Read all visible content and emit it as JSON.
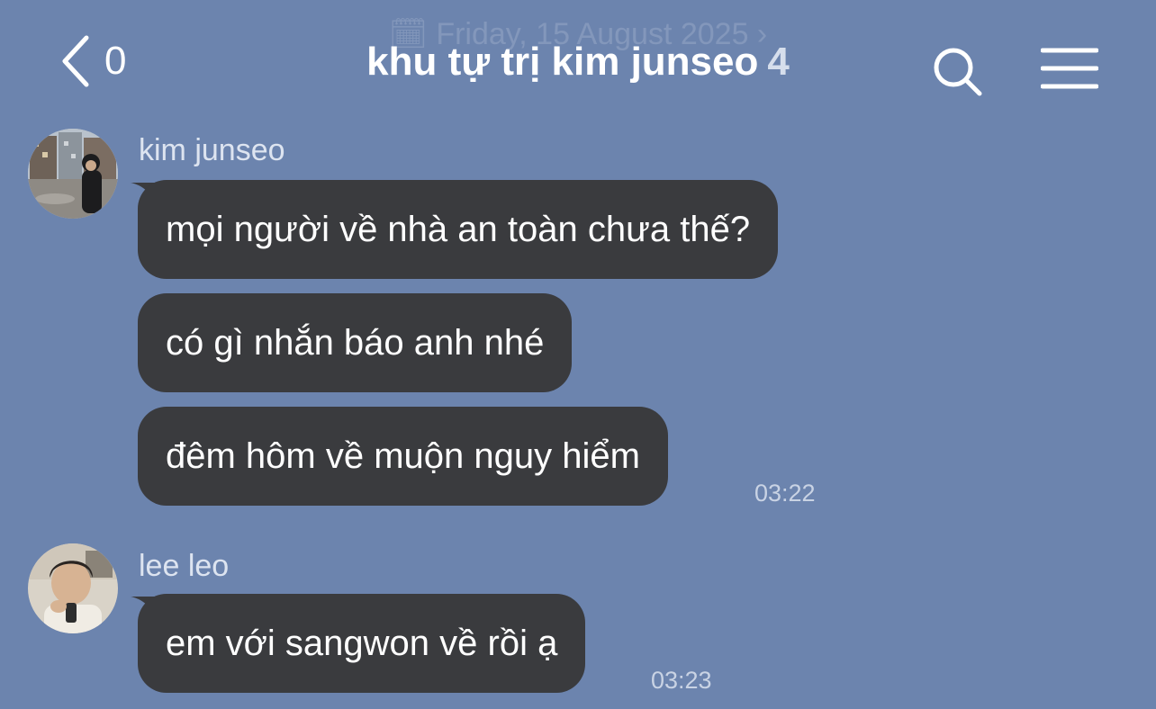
{
  "header": {
    "date_banner": "🗓 Friday, 15 August 2025 ›",
    "back_count": "0",
    "chat_title": "khu tự trị kim junseo",
    "member_count": "4"
  },
  "messages": [
    {
      "sender": "kim junseo",
      "bubbles": [
        "mọi người về nhà an toàn chưa thế?",
        "có gì nhắn báo anh nhé",
        "đêm hôm về muộn nguy hiểm"
      ],
      "time": "03:22"
    },
    {
      "sender": "lee leo",
      "bubbles": [
        "em với sangwon về rồi ạ"
      ],
      "time": "03:23"
    }
  ],
  "icons": {
    "back": "chevron-left-icon",
    "search": "search-icon",
    "menu": "hamburger-menu-icon"
  },
  "colors": {
    "background": "#6c84ae",
    "bubble": "#3a3b3e",
    "text": "#ffffff",
    "muted_text": "#dde4f0"
  }
}
